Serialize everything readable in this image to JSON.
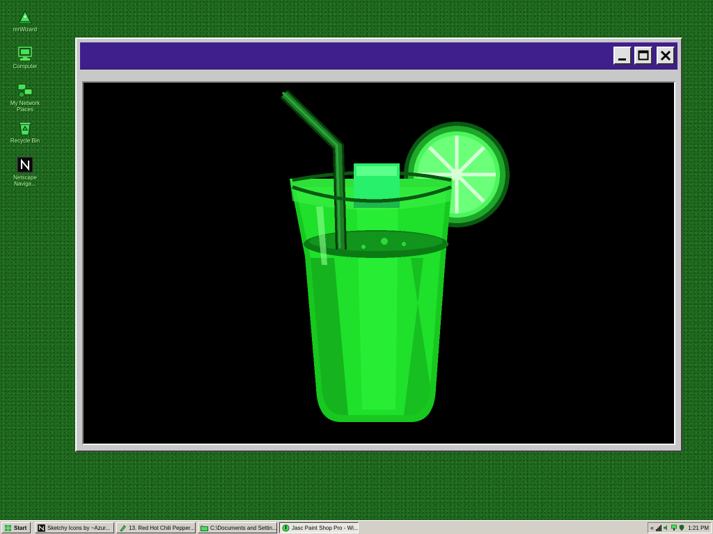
{
  "desktop": {
    "icons": [
      {
        "label": "mrWizard",
        "icon": "wizard-hat-icon"
      },
      {
        "label": "Computer",
        "icon": "computer-icon"
      },
      {
        "label": "My Network Places",
        "icon": "network-places-icon"
      },
      {
        "label": "Recycle Bin",
        "icon": "recycle-bin-icon"
      },
      {
        "label": "Netscape Naviga...",
        "icon": "netscape-icon"
      }
    ]
  },
  "window": {
    "title": "",
    "content": "Pixel-art cocktail glass with straw and lime slice"
  },
  "colors": {
    "desktop": "#1f6a1f",
    "titlebar": "#3f1f8c",
    "icon_label": "#b6ff9c",
    "glass_green": "#22e02a",
    "lime_green": "#3cff50"
  },
  "taskbar": {
    "start_label": "Start",
    "buttons": [
      {
        "label": "Sketchy Icons by ~Azur...",
        "icon": "browser-page-icon"
      },
      {
        "label": "13. Red Hot Chili Pepper...",
        "icon": "music-icon"
      },
      {
        "label": "C:\\Documents and Settin...",
        "icon": "folder-icon"
      },
      {
        "label": "Jasc Paint Shop Pro - Wi...",
        "icon": "paint-shop-pro-icon"
      }
    ],
    "tray": {
      "chevron": "«",
      "icons": [
        "signal-icon",
        "volume-icon",
        "network-icon",
        "antivirus-icon"
      ],
      "clock": "1:21 PM"
    }
  }
}
